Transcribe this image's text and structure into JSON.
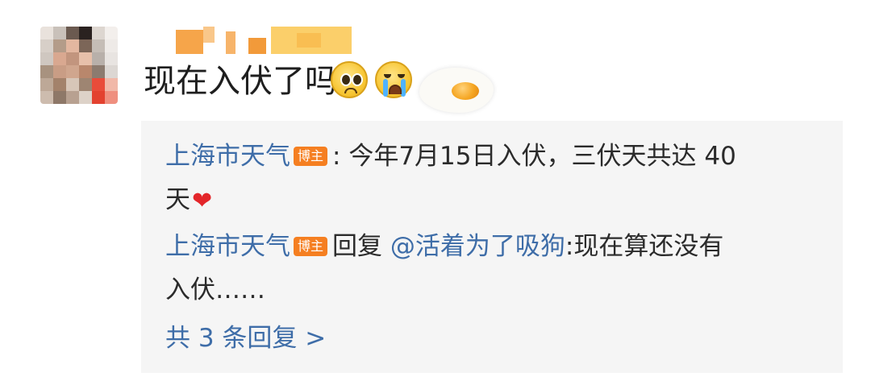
{
  "comment": {
    "text": "现在入伏了吗",
    "emojis": [
      "pleading-face-icon",
      "crying-face-icon"
    ]
  },
  "replies": [
    {
      "author": "上海市天气",
      "badge": "博主",
      "separator": ":",
      "text_line1": "今年7月15日入伏，三伏天共达 40",
      "text_line2": "天",
      "trailing_icon": "heart-icon"
    },
    {
      "author": "上海市天气",
      "badge": "博主",
      "reply_word": "回复",
      "mention": "@活着为了吸狗",
      "text_line1": ":现在算还没有",
      "text_line2": "入伏……"
    }
  ],
  "more_replies": "共 3 条回复 >",
  "colors": {
    "link": "#3e6da8",
    "badge": "#f57f21",
    "reply_bg": "#f5f5f5",
    "heart": "#e3262a"
  }
}
